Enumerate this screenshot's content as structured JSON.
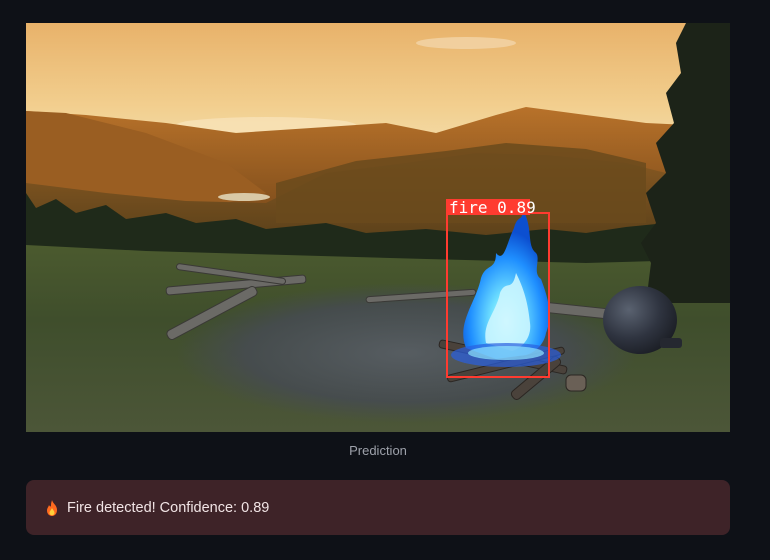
{
  "prediction": {
    "caption": "Prediction",
    "detection": {
      "class_label": "fire",
      "confidence": "0.89",
      "box_color": "#ff3b30"
    }
  },
  "alert": {
    "icon": "fire-icon",
    "message": "Fire detected! Confidence: 0.89",
    "background": "#3e2328"
  },
  "theme": {
    "page_background": "#0e1117",
    "caption_color": "#9ea2ab"
  }
}
